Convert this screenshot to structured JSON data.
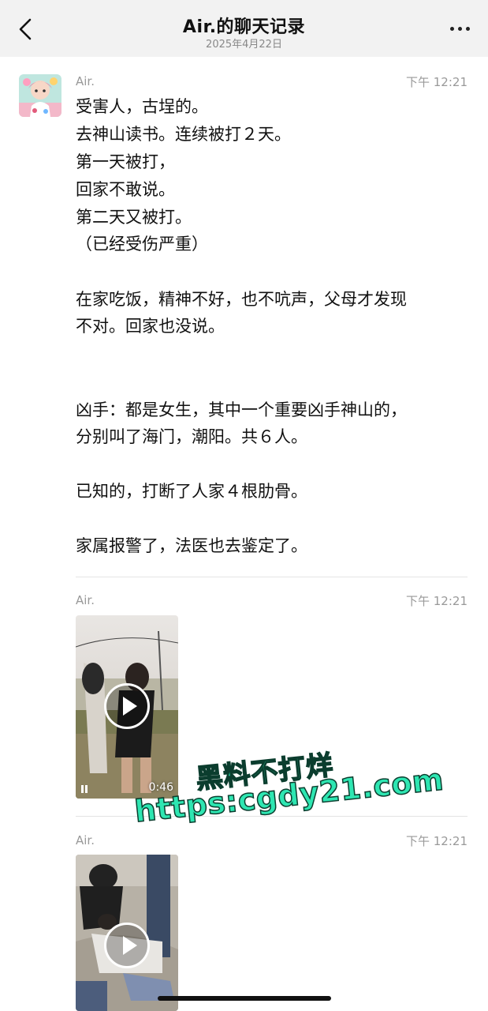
{
  "header": {
    "title": "Air.的聊天记录",
    "date": "2025年4月22日"
  },
  "messages": [
    {
      "sender": "Air.",
      "time": "下午 12:21",
      "lines": [
        "受害人，古埕的。",
        "去神山读书。连续被打２天。",
        "第一天被打，",
        "回家不敢说。",
        "第二天又被打。",
        "（已经受伤严重）",
        "",
        "在家吃饭，精神不好，也不吭声，父母才发现",
        "不对。回家也没说。",
        "",
        "",
        "凶手：都是女生，其中一个重要凶手神山的，",
        "分别叫了海门，潮阳。共６人。",
        "",
        "已知的，打断了人家４根肋骨。",
        "",
        "家属报警了，法医也去鉴定了。"
      ]
    },
    {
      "sender": "Air.",
      "time": "下午 12:21",
      "video_duration": "0:46"
    },
    {
      "sender": "Air.",
      "time": "下午 12:21",
      "video_duration": ""
    }
  ],
  "watermark": {
    "line1": "黑料不打烊",
    "line2": "https:cgdy21.com"
  },
  "icons": {
    "back": "chevron-left-icon",
    "more": "more-dots-icon",
    "play": "play-icon"
  }
}
